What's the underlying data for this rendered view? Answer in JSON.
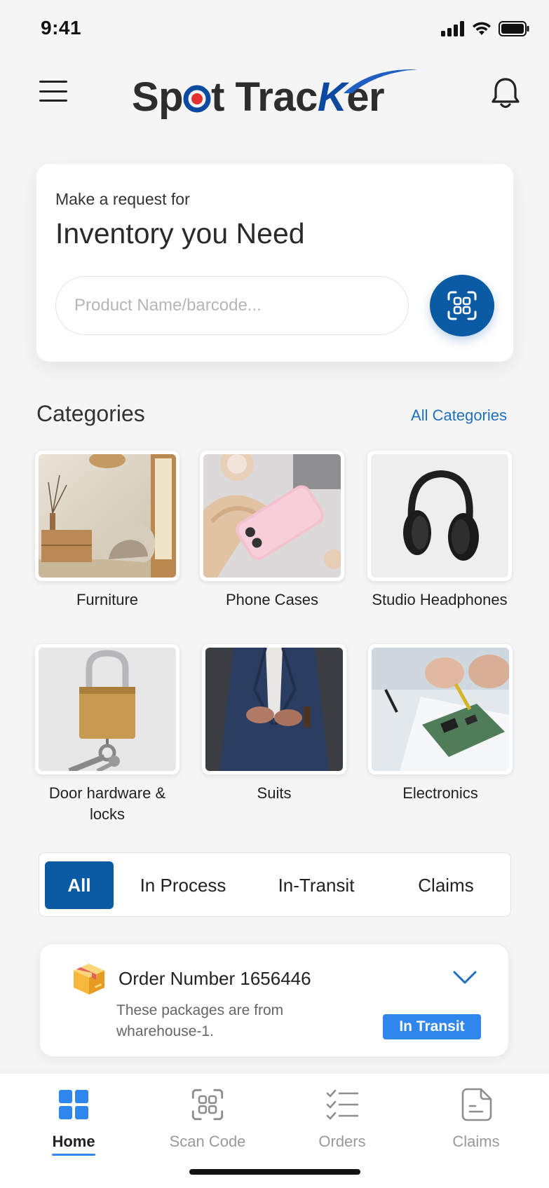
{
  "status_bar": {
    "time": "9:41"
  },
  "header": {
    "logo_part1": "Sp",
    "logo_part2": "t Trac",
    "logo_part3": "er",
    "logo_k": "K"
  },
  "request": {
    "subtitle": "Make a request for",
    "title": "Inventory you Need",
    "search_placeholder": "Product Name/barcode..."
  },
  "categories": {
    "title": "Categories",
    "all_label": "All Categories",
    "items": [
      {
        "label": "Furniture"
      },
      {
        "label": "Phone Cases"
      },
      {
        "label": "Studio Headphones"
      },
      {
        "label": "Door hardware & locks"
      },
      {
        "label": "Suits"
      },
      {
        "label": "Electronics"
      }
    ]
  },
  "filters": {
    "tabs": [
      {
        "label": "All",
        "active": true
      },
      {
        "label": "In Process"
      },
      {
        "label": "In-Transit"
      },
      {
        "label": "Claims"
      }
    ]
  },
  "order": {
    "title": "Order Number 1656446",
    "description": "These packages are from wharehouse-1.",
    "status": "In Transit"
  },
  "bottom_nav": {
    "items": [
      {
        "label": "Home",
        "active": true
      },
      {
        "label": "Scan Code"
      },
      {
        "label": "Orders"
      },
      {
        "label": "Claims"
      }
    ]
  },
  "colors": {
    "primary": "#0b5aa4",
    "accent": "#2f86ec",
    "link": "#1f6fc0",
    "logo_dot": "#e53030"
  }
}
